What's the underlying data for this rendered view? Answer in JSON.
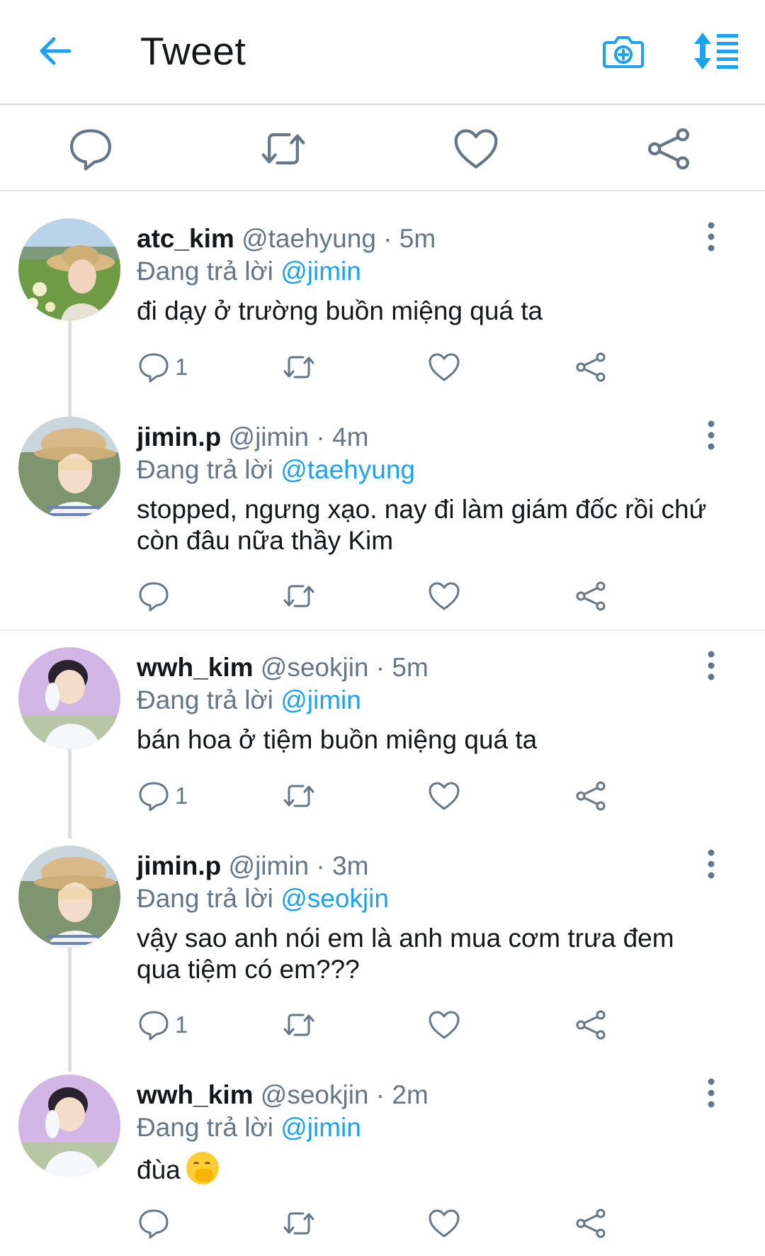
{
  "header": {
    "title": "Tweet",
    "back_icon": "arrow-left-icon",
    "camera_icon": "camera-plus-icon",
    "sort_icon": "sort-list-icon",
    "accent": "#1da1f2"
  },
  "main_actions": [
    "reply-icon",
    "retweet-icon",
    "like-icon",
    "share-icon"
  ],
  "reply_prefix": "Đang trả lời",
  "tweets": [
    {
      "name": "atc_kim",
      "meta": "@taehyung · 5m",
      "reply_to": "@jimin",
      "text": "đi dạy ở trường buồn miệng quá ta",
      "reply_count": "1"
    },
    {
      "name": "jimin.p",
      "meta": "@jimin · 4m",
      "reply_to": "@taehyung",
      "text": "stopped, ngưng xạo. nay đi làm giám đốc rồi chứ còn đâu nữa thầy Kim",
      "reply_count": ""
    },
    {
      "name": "wwh_kim",
      "meta": "@seokjin · 5m",
      "reply_to": "@jimin",
      "text": "bán hoa ở tiệm buồn miệng quá ta",
      "reply_count": "1"
    },
    {
      "name": "jimin.p",
      "meta": "@jimin · 3m",
      "reply_to": "@seokjin",
      "text": "vậy sao anh nói em là anh mua cơm trưa đem qua tiệm có em???",
      "reply_count": "1"
    },
    {
      "name": "wwh_kim",
      "meta": "@seokjin · 2m",
      "reply_to": "@jimin",
      "text": "đùa",
      "emoji": "hand-over-mouth-emoji",
      "reply_count": ""
    }
  ]
}
